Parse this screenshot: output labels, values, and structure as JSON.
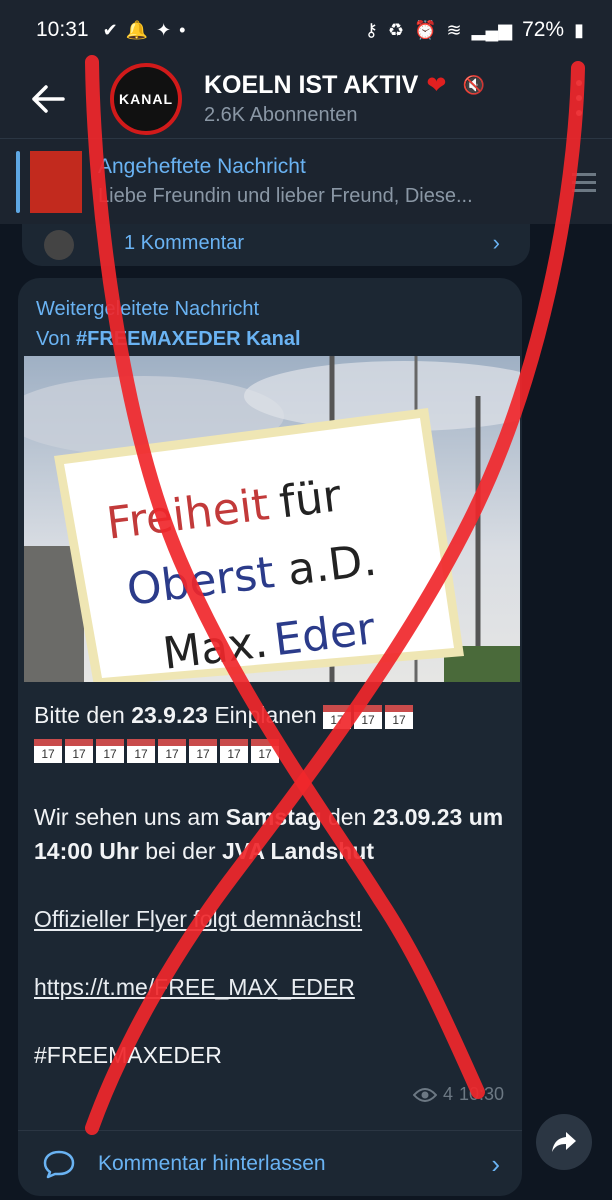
{
  "status": {
    "time": "10:31",
    "battery": "72%"
  },
  "header": {
    "avatar_text": "KANAL",
    "title": "KOELN IST AKTIV",
    "subtitle": "2.6K Abonnenten"
  },
  "pinned": {
    "title": "Angeheftete Nachricht",
    "body": "Liebe Freundin und  lieber Freund,   Diese..."
  },
  "prev_message": {
    "comment": "1 Kommentar"
  },
  "message": {
    "forward_label": "Weitergeleitete Nachricht",
    "forward_from_prefix": "Von ",
    "forward_from": "#FREEMAXEDER Kanal",
    "photo_sign": {
      "line1_red": "Freiheit",
      "line1_black": " für",
      "line2_blue": "Oberst",
      "line2_black": " a.D.",
      "line3_black": "Max.",
      "line3_blue": " Eder"
    },
    "line1_prefix": "Bitte den ",
    "line1_bold": "23.9.23",
    "line1_suffix": " Einplanen ",
    "cal_label": "17",
    "para2_a": "Wir sehen uns am ",
    "para2_b": "Samstag",
    "para2_c": " den ",
    "para2_d": "23.09.23 um 14:00 Uhr",
    "para2_e": " bei der ",
    "para2_f": "JVA Landshut",
    "para3": "Offizieller Flyer folgt demnächst!",
    "link": "https://t.me/FREE_MAX_EDER",
    "hashtag": "#FREEMAXEDER",
    "views": "4",
    "time": "10:30",
    "comment_label": "Kommentar hinterlassen"
  },
  "colors": {
    "bg": "#0e1621",
    "bubble": "#1c2733",
    "accent": "#6ab3f3",
    "overlay_red": "#f0272b"
  }
}
